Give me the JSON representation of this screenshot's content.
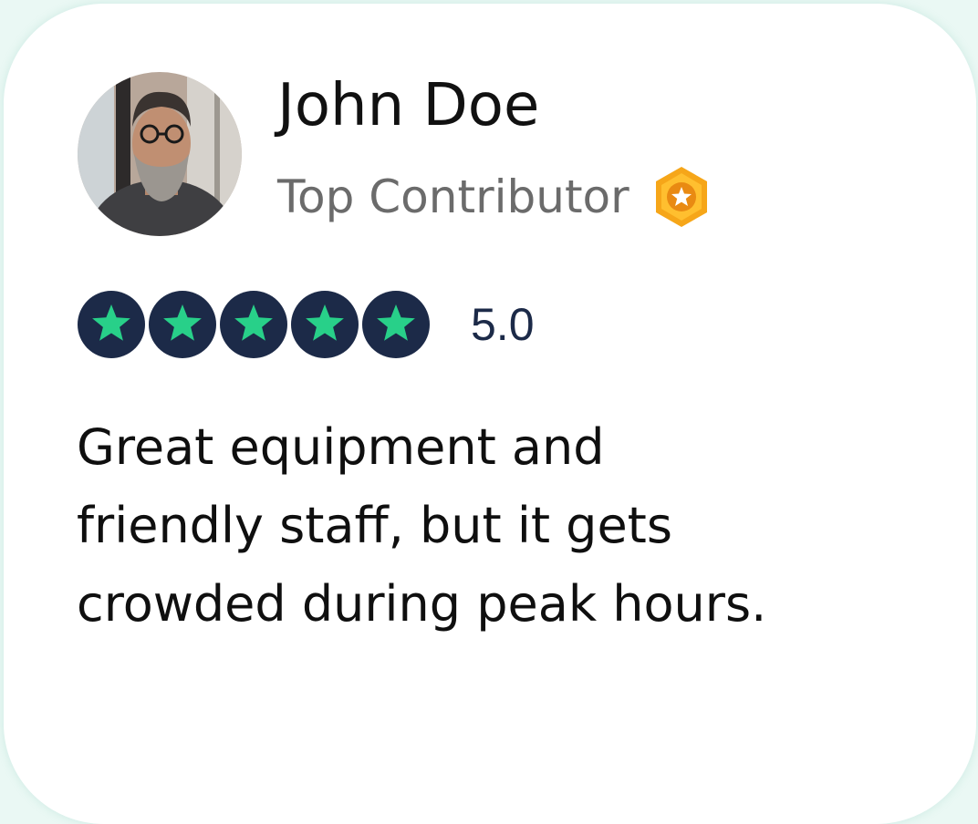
{
  "review_card": {
    "reviewer_name": "John Doe",
    "reviewer_title": "Top Contributor",
    "badge_icon": "star-hexagon-badge-icon",
    "rating_value": 5,
    "rating_max": 5,
    "rating_label": "5.0",
    "review_text": "Great equipment and friendly staff, but it gets crowded during peak hours."
  },
  "colors": {
    "star_fill": "#28d089",
    "star_background": "#1c2a48",
    "badge_outer": "#f6a619",
    "badge_inner": "#ffbf2f",
    "score_text": "#1c2a48",
    "subtitle_text": "#6b6b6b"
  }
}
